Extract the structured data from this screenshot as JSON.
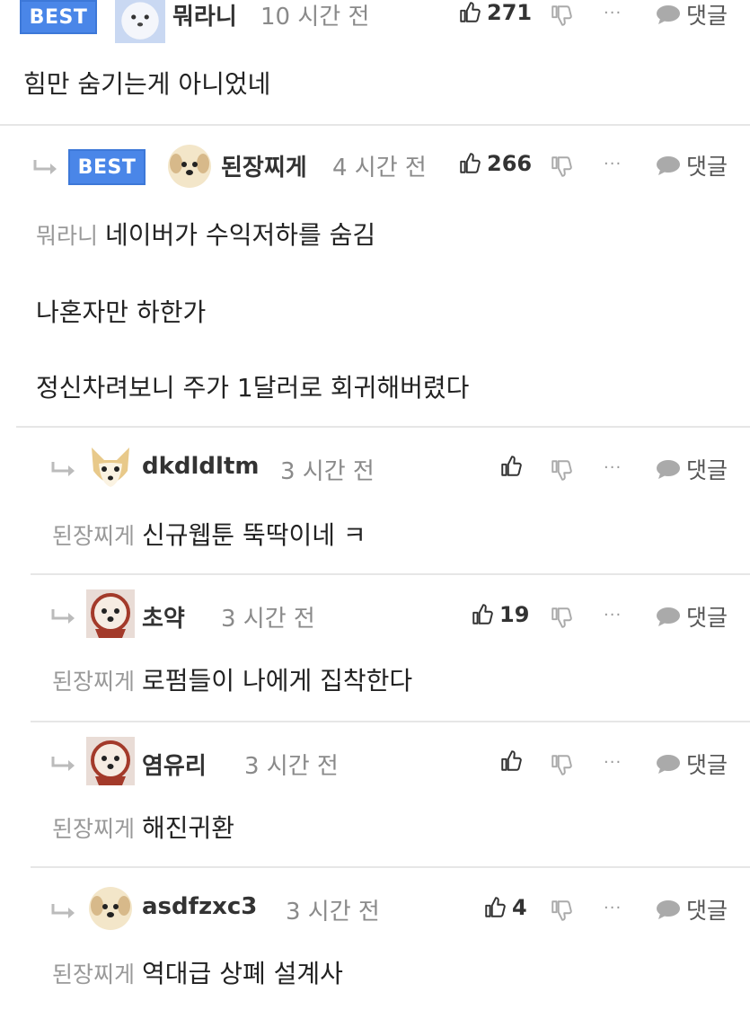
{
  "comments": [
    {
      "best_badge": "BEST",
      "author": "뭐라니",
      "time": "10 시간 전",
      "likes": "271",
      "reply_label": "댓글",
      "more_label": "···",
      "lines": [
        "힘만 숨기는게 아니었네"
      ]
    },
    {
      "best_badge": "BEST",
      "author": "된장찌게",
      "time": "4 시간 전",
      "likes": "266",
      "reply_label": "댓글",
      "more_label": "···",
      "mention": "뭐라니",
      "lines": [
        "네이버가 수익저하를 숨김",
        "나혼자만 하한가",
        "정신차려보니 주가 1달러로 회귀해버렸다"
      ]
    },
    {
      "author": "dkdldltm",
      "time": "3 시간 전",
      "likes": "",
      "reply_label": "댓글",
      "more_label": "···",
      "mention": "된장찌게",
      "lines": [
        "신규웹툰 뚝딱이네 ㅋ"
      ]
    },
    {
      "author": "초약",
      "time": "3 시간 전",
      "likes": "19",
      "reply_label": "댓글",
      "more_label": "···",
      "mention": "된장찌게",
      "lines": [
        "로펌들이 나에게 집착한다"
      ]
    },
    {
      "author": "염유리",
      "time": "3 시간 전",
      "likes": "",
      "reply_label": "댓글",
      "more_label": "···",
      "mention": "된장찌게",
      "lines": [
        "해진귀환"
      ]
    },
    {
      "author": "asdfzxc3",
      "time": "3 시간 전",
      "likes": "4",
      "reply_label": "댓글",
      "more_label": "···",
      "mention": "된장찌게",
      "lines": [
        "역대급 상폐 설계사"
      ]
    }
  ],
  "colors": {
    "best": "#4a86e8",
    "divider": "#e6e6e6",
    "mention": "#999999"
  }
}
